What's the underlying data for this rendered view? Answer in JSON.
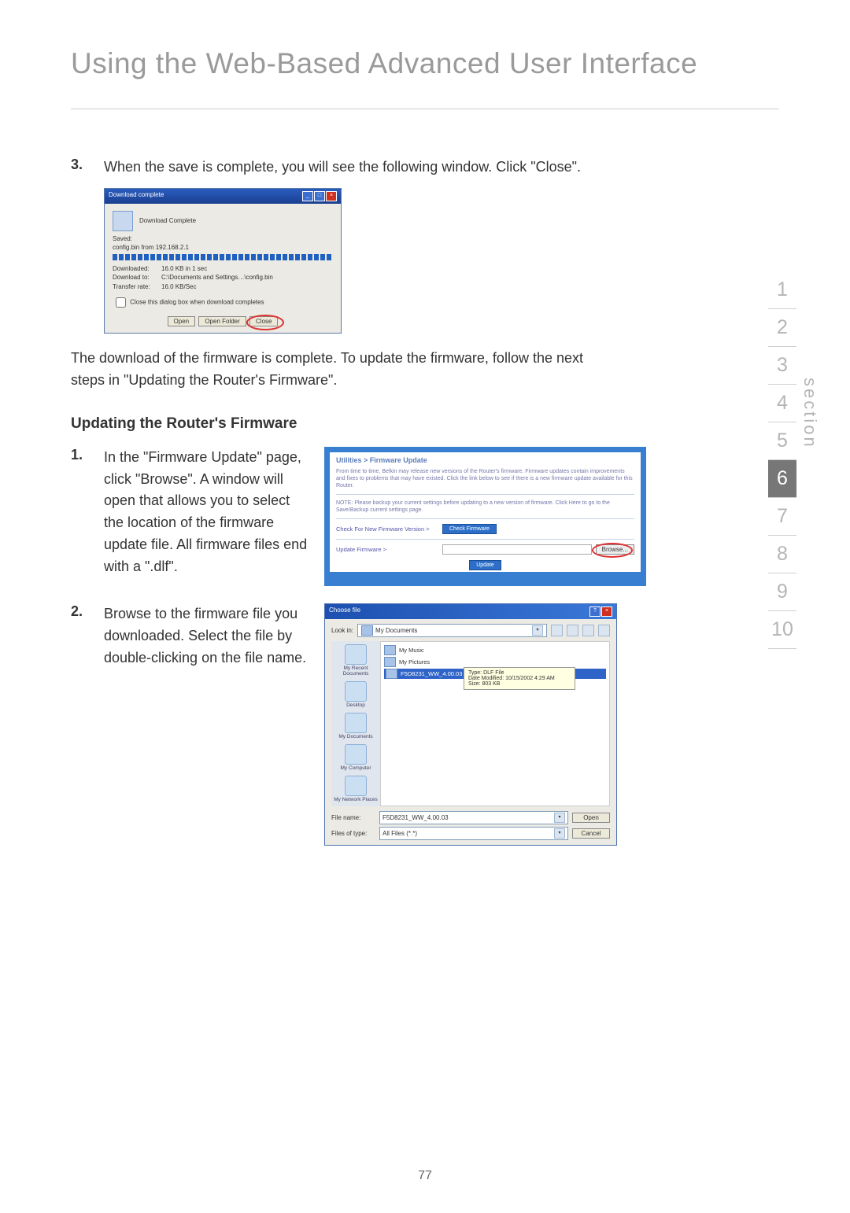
{
  "page": {
    "title": "Using the Web-Based Advanced User Interface",
    "number": "77"
  },
  "sections": [
    "1",
    "2",
    "3",
    "4",
    "5",
    "6",
    "7",
    "8",
    "9",
    "10"
  ],
  "active_section": "6",
  "section_label": "section",
  "step3": {
    "num": "3.",
    "text": "When the save is complete, you will see the following window. Click \"Close\"."
  },
  "dlwin": {
    "title": "Download complete",
    "status": "Download Complete",
    "saved_label": "Saved:",
    "saved_file": "config.bin from 192.168.2.1",
    "downloaded_label": "Downloaded:",
    "downloaded": "16.0 KB in 1 sec",
    "downloadto_label": "Download to:",
    "downloadto": "C:\\Documents and Settings…\\config.bin",
    "rate_label": "Transfer rate:",
    "rate": "16.0 KB/Sec",
    "close_check": "Close this dialog box when download completes",
    "btn_open": "Open",
    "btn_folder": "Open Folder",
    "btn_close": "Close"
  },
  "after_dl": "The download of the firmware is complete. To update the firmware, follow the next steps in \"Updating the Router's Firmware\".",
  "subheading": "Updating the Router's Firmware",
  "step1": {
    "num": "1.",
    "text": "In the \"Firmware Update\" page, click \"Browse\". A window will open that allows you to select the location of the firmware update file. All firmware files end with a \".dlf\"."
  },
  "fwpanel": {
    "heading": "Utilities > Firmware Update",
    "p1": "From time to time, Belkin may release new versions of the Router's firmware. Firmware updates contain improvements and fixes to problems that may have existed. Click the link below to see if there is a new firmware update available for this Router.",
    "p2": "NOTE: Please backup your current settings before updating to a new version of firmware. Click Here to go to the Save/Backup current settings page.",
    "row1": "Check For New Firmware Version >",
    "btn_check": "Check Firmware",
    "row2": "Update Firmware >",
    "btn_browse": "Browse...",
    "btn_update": "Update"
  },
  "step2": {
    "num": "2.",
    "text": "Browse to the firmware file you downloaded. Select the file by double-clicking on the file name."
  },
  "choose": {
    "title": "Choose file",
    "lookin": "Look in:",
    "folder": "My Documents",
    "items": [
      "My Music",
      "My Pictures",
      "F5D8231_WW_4.00.03"
    ],
    "tip_line1": "Type: DLF File",
    "tip_line2": "Date Modified: 10/15/2002 4:29 AM",
    "tip_line3": "Size: 803 KB",
    "sidebar": [
      "My Recent Documents",
      "Desktop",
      "My Documents",
      "My Computer",
      "My Network Places"
    ],
    "fn_label": "File name:",
    "fn_value": "F5D8231_WW_4.00.03",
    "ft_label": "Files of type:",
    "ft_value": "All Files (*.*)",
    "btn_open": "Open",
    "btn_cancel": "Cancel"
  }
}
